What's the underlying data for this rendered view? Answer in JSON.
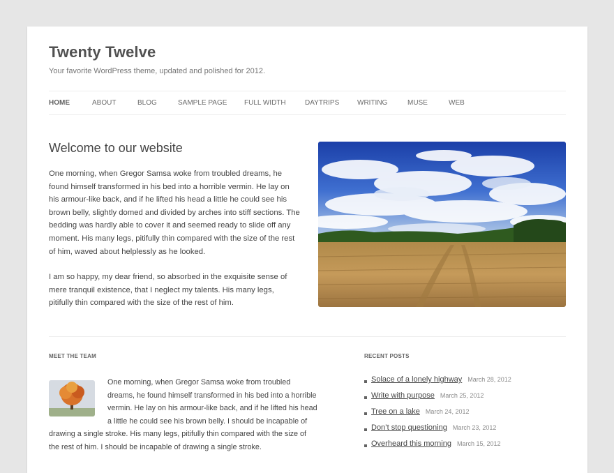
{
  "header": {
    "site_title": "Twenty Twelve",
    "site_description": "Your favorite WordPress theme, updated and polished for 2012."
  },
  "nav": {
    "items": [
      {
        "label": "HOME",
        "active": true
      },
      {
        "label": "ABOUT"
      },
      {
        "label": "BLOG"
      },
      {
        "label": "SAMPLE PAGE"
      },
      {
        "label": "FULL WIDTH"
      },
      {
        "label": "DAYTRIPS"
      },
      {
        "label": "WRITING"
      },
      {
        "label": "MUSE"
      },
      {
        "label": "WEB"
      }
    ]
  },
  "welcome": {
    "title": "Welcome to our website",
    "paragraphs": [
      "One morning, when Gregor Samsa woke from troubled dreams, he found himself transformed in his bed into a horrible vermin. He lay on his armour-like back, and if he lifted his head a little he could see his brown belly, slightly domed and divided by arches into stiff sections. The bedding was hardly able to cover it and seemed ready to slide off any moment. His many legs, pitifully thin compared with the size of the rest of him, waved about helplessly as he looked.",
      "I am so happy, my dear friend, so absorbed in the exquisite sense of mere tranquil existence, that I neglect my talents. His many legs, pitifully thin compared with the size of the rest of him."
    ],
    "image_icon": "wheat-field-landscape-image"
  },
  "team": {
    "title": "MEET THE TEAM",
    "text": "One morning, when Gregor Samsa woke from troubled dreams, he found himself transformed in his bed into a horrible vermin. He lay on his armour-like back, and if he lifted his head a little he could see his brown belly. I should be incapable of drawing a single stroke. His many legs, pitifully thin compared with the size of the rest of him. I should be incapable of drawing a single stroke.",
    "image_icon": "autumn-tree-image"
  },
  "recent_posts": {
    "title": "RECENT POSTS",
    "items": [
      {
        "title": "Solace of a lonely highway",
        "date": "March 28, 2012"
      },
      {
        "title": "Write with purpose",
        "date": "March 25, 2012"
      },
      {
        "title": "Tree on a lake",
        "date": "March 24, 2012"
      },
      {
        "title": "Don’t stop questioning",
        "date": "March 23, 2012"
      },
      {
        "title": "Overheard this morning",
        "date": "March 15, 2012"
      }
    ]
  },
  "colors": {
    "background": "#e6e6e6",
    "page": "#ffffff",
    "text": "#444444",
    "muted": "#8a8a8a"
  }
}
